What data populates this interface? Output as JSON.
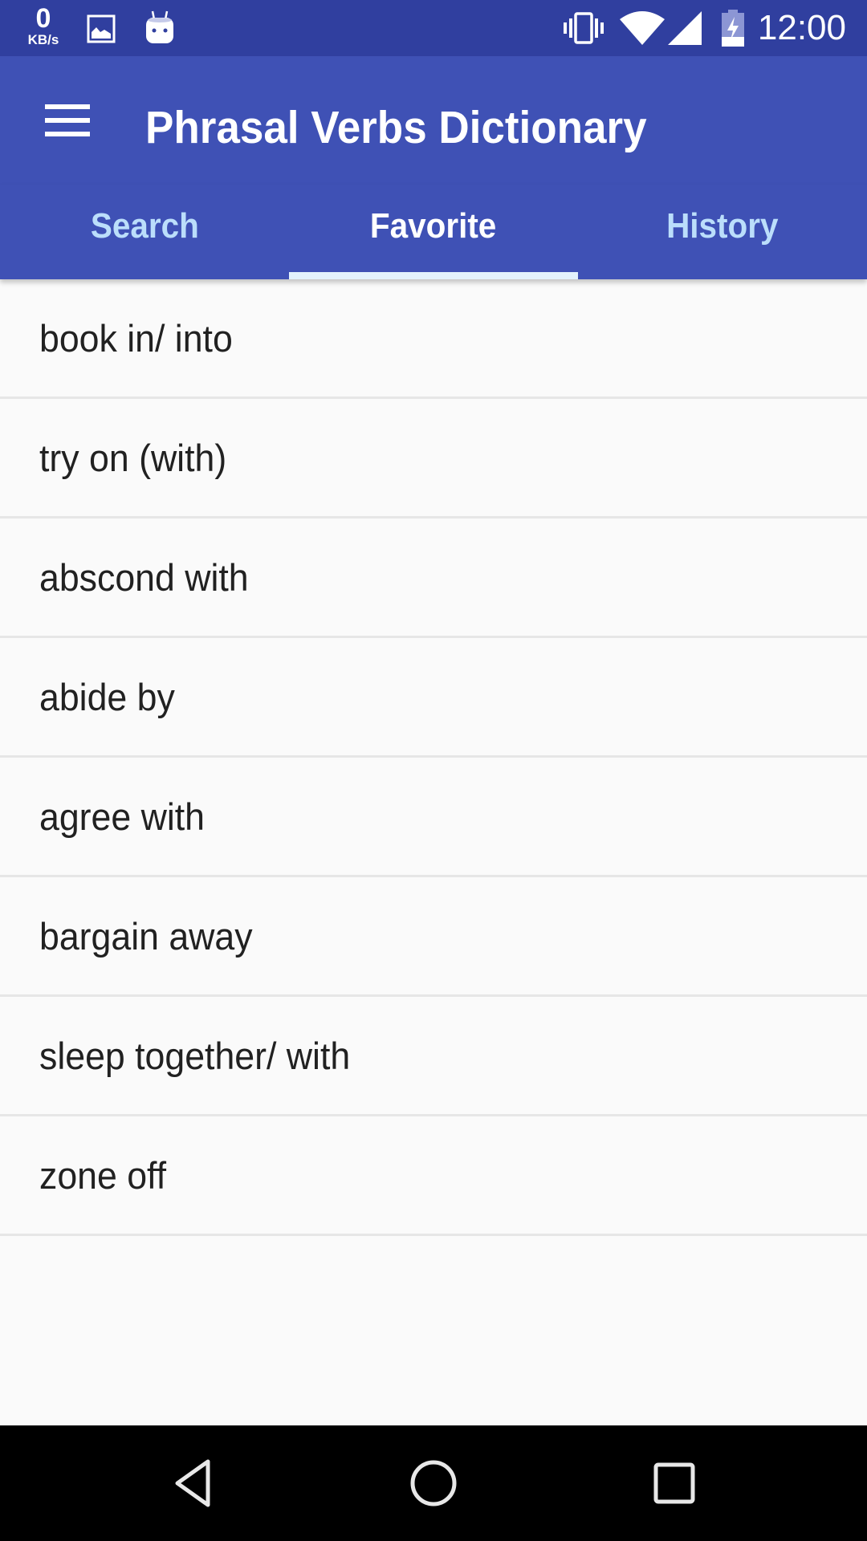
{
  "status_bar": {
    "net_speed_value": "0",
    "net_speed_unit": "KB/s",
    "left_icons": [
      "image-icon",
      "android-icon"
    ],
    "right_icons": [
      "vibrate-icon",
      "wifi-icon",
      "cell-signal-icon",
      "battery-charging-icon"
    ],
    "time": "12:00"
  },
  "toolbar": {
    "menu_icon": "hamburger-menu-icon",
    "title": "Phrasal Verbs Dictionary"
  },
  "tabs": [
    {
      "label": "Search",
      "active": false
    },
    {
      "label": "Favorite",
      "active": true
    },
    {
      "label": "History",
      "active": false
    }
  ],
  "favorites": [
    "book in/ into",
    "try on (with)",
    "abscond with",
    "abide by",
    "agree with",
    "bargain away",
    "sleep together/ with",
    "zone off"
  ],
  "nav_bar": {
    "buttons": [
      "back-icon",
      "home-icon",
      "recents-icon"
    ]
  },
  "colors": {
    "status_bar": "#303f9f",
    "primary": "#3f51b5",
    "tab_inactive": "#bbdefb",
    "tab_indicator": "#e3f2fd",
    "list_bg": "#fafafa",
    "divider": "#e6e6e6",
    "text": "#212121"
  }
}
